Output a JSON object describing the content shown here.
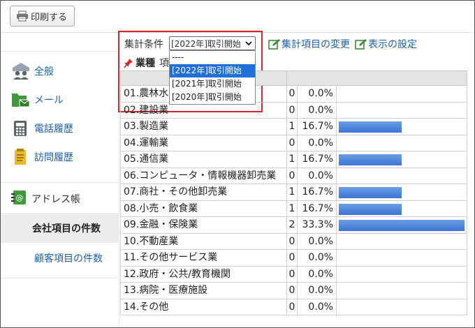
{
  "toolbar": {
    "print_label": "印刷する"
  },
  "sidebar": {
    "items": [
      {
        "label": "全般",
        "icon": "people-icon"
      },
      {
        "label": "メール",
        "icon": "mail-folder-icon"
      },
      {
        "label": "電話履歴",
        "icon": "phone-icon"
      },
      {
        "label": "訪問履歴",
        "icon": "notepad-icon"
      }
    ],
    "address_book": {
      "label": "アドレス帳",
      "icon": "address-book-icon"
    },
    "company_count": {
      "label": "会社項目の件数"
    },
    "customer_count": {
      "label": "顧客項目の件数"
    }
  },
  "condition": {
    "label": "集計条件",
    "selected": "[2022年]取引開始",
    "options": [
      "----",
      "[2022年]取引開始",
      "[2021年]取引開始",
      "[2020年]取引開始"
    ],
    "highlighted_index": 1
  },
  "links": {
    "change_items": "集計項目の変更",
    "display_settings": "表示の設定"
  },
  "section": {
    "title": "業種",
    "subtitle": "項"
  },
  "table": {
    "rows": [
      {
        "name": "01.農林水",
        "count": "0",
        "pct": "0.0%",
        "share": 0
      },
      {
        "name": "02.建設業",
        "count": "0",
        "pct": "0.0%",
        "share": 0
      },
      {
        "name": "03.製造業",
        "count": "1",
        "pct": "16.7%",
        "share": 0.167
      },
      {
        "name": "04.運輸業",
        "count": "0",
        "pct": "0.0%",
        "share": 0
      },
      {
        "name": "05.通信業",
        "count": "1",
        "pct": "16.7%",
        "share": 0.167
      },
      {
        "name": "06.コンピュータ・情報機器卸売業",
        "count": "0",
        "pct": "0.0%",
        "share": 0
      },
      {
        "name": "07.商社・その他卸売業",
        "count": "1",
        "pct": "16.7%",
        "share": 0.167
      },
      {
        "name": "08.小売・飲食業",
        "count": "1",
        "pct": "16.7%",
        "share": 0.167
      },
      {
        "name": "09.金融・保険業",
        "count": "2",
        "pct": "33.3%",
        "share": 0.333
      },
      {
        "name": "10.不動産業",
        "count": "0",
        "pct": "0.0%",
        "share": 0
      },
      {
        "name": "11.その他サービス業",
        "count": "0",
        "pct": "0.0%",
        "share": 0
      },
      {
        "name": "12.政府・公共/教育機関",
        "count": "0",
        "pct": "0.0%",
        "share": 0
      },
      {
        "name": "13.病院・医療施設",
        "count": "0",
        "pct": "0.0%",
        "share": 0
      },
      {
        "name": "14.その他",
        "count": "0",
        "pct": "0.0%",
        "share": 0
      }
    ]
  },
  "colors": {
    "link": "#1a5fa8",
    "bar": "#3d74d4",
    "highlight": "#1f6fd8",
    "callout": "#e0202a"
  }
}
